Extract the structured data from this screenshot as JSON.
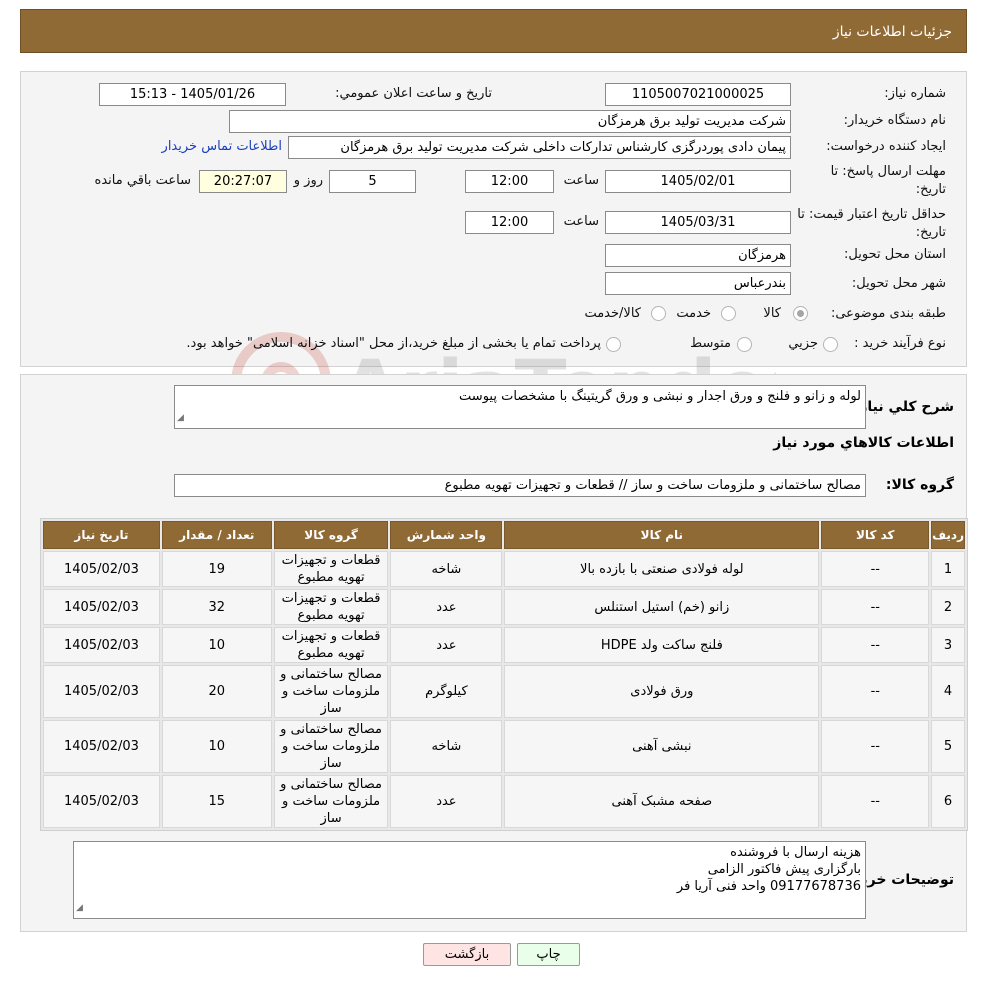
{
  "header": {
    "title": "جزئیات اطلاعات نیاز"
  },
  "form": {
    "need_number_label": "شماره نیاز:",
    "need_number": "1105007021000025",
    "announce_label": "تاریخ و ساعت اعلان عمومي:",
    "announce_value": "1405/01/26 - 15:13",
    "buyer_org_label": "نام دستگاه خریدار:",
    "buyer_org": "شرکت مدیریت تولید برق هرمزگان",
    "requester_label": "ایجاد کننده درخواست:",
    "requester": "پیمان دادی پوردرگزی کارشناس تدارکات داخلی شرکت مدیریت تولید برق هرمزگان",
    "contact_link": "اطلاعات تماس خریدار",
    "deadline_label_1": "مهلت ارسال پاسخ: تا",
    "deadline_label_2": "تاریخ:",
    "deadline_date": "1405/02/01",
    "time_label": "ساعت",
    "deadline_time": "12:00",
    "days_value": "5",
    "days_label": "روز و",
    "remaining_time": "20:27:07",
    "remaining_label": "ساعت باقي مانده",
    "validity_label_1": "حداقل تاریخ اعتبار قیمت: تا",
    "validity_label_2": "تاریخ:",
    "validity_date": "1405/03/31",
    "validity_time": "12:00",
    "province_label": "استان محل تحویل:",
    "province": "هرمزگان",
    "city_label": "شهر محل تحویل:",
    "city": "بندرعباس",
    "category_label": "طبقه بندی موضوعی:",
    "category_options": [
      "کالا",
      "خدمت",
      "کالا/خدمت"
    ],
    "category_selected": "کالا",
    "process_label": "نوع فرآیند خرید :",
    "process_options": [
      "جزيي",
      "متوسط"
    ],
    "process_note": "پرداخت تمام یا بخشی از مبلغ خرید،از محل \"اسناد خزانه اسلامی\" خواهد بود."
  },
  "details": {
    "description_label": "شرح كلي نياز:",
    "description": "لوله و زانو و فلنج و  ورق اجدار و نبشی و ورق گریتینگ با مشخصات پیوست",
    "goods_info_title": "اطلاعات كالاهاي مورد نياز",
    "goods_group_label": "گروه كالا:",
    "goods_group": "مصالح ساختمانی و ملزومات ساخت و ساز //  قطعات و تجهیزات تهویه مطبوع",
    "table": {
      "headers": [
        "رديف",
        "کد کالا",
        "نام کالا",
        "واحد شمارش",
        "گروه کالا",
        "تعداد / مقدار",
        "تاریخ نیاز"
      ],
      "rows": [
        [
          "1",
          "--",
          "لوله فولادی صنعتی با بازده بالا",
          "شاخه",
          "قطعات و تجهیزات تهویه مطبوع",
          "19",
          "1405/02/03"
        ],
        [
          "2",
          "--",
          "زانو (خم) استیل استنلس",
          "عدد",
          "قطعات و تجهیزات تهویه مطبوع",
          "32",
          "1405/02/03"
        ],
        [
          "3",
          "--",
          "فلنج ساکت ولد HDPE",
          "عدد",
          "قطعات و تجهیزات تهویه مطبوع",
          "10",
          "1405/02/03"
        ],
        [
          "4",
          "--",
          "ورق فولادی",
          "کیلوگرم",
          "مصالح ساختمانی و ملزومات ساخت و ساز",
          "20",
          "1405/02/03"
        ],
        [
          "5",
          "--",
          "نبشی آهنی",
          "شاخه",
          "مصالح ساختمانی و ملزومات ساخت و ساز",
          "10",
          "1405/02/03"
        ],
        [
          "6",
          "--",
          "صفحه مشبک آهنی",
          "عدد",
          "مصالح ساختمانی و ملزومات ساخت و ساز",
          "15",
          "1405/02/03"
        ]
      ]
    },
    "buyer_notes_label": "توضيحات خريدار:",
    "buyer_notes": [
      "هزینه ارسال با فروشنده",
      "بارگزاری پیش فاکتور الزامی",
      "09177678736 واحد فنی آریا فر"
    ]
  },
  "buttons": {
    "print": "چاپ",
    "back": "بازگشت"
  },
  "watermark": {
    "text": "AriaTender.neT"
  },
  "colors": {
    "header_bg": "#8f6a35",
    "link": "#1a3ec0",
    "back_button": "#ffe4e4",
    "print_button": "#eaffea"
  }
}
